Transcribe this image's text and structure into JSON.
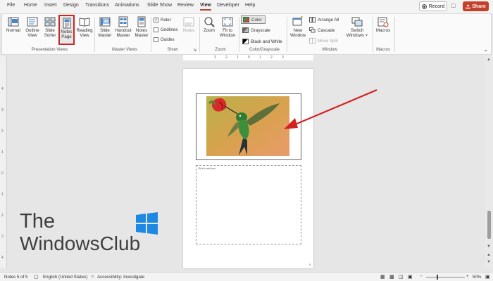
{
  "menu": {
    "tabs": [
      "File",
      "Home",
      "Insert",
      "Design",
      "Transitions",
      "Animations",
      "Slide Show",
      "Review",
      "View",
      "Developer",
      "Help"
    ],
    "active_tab": "View",
    "record_label": "Record",
    "share_label": "Share"
  },
  "ribbon": {
    "presentation_views": {
      "label": "Presentation Views",
      "normal": "Normal",
      "outline_view_1": "Outline",
      "outline_view_2": "View",
      "slide_sorter_1": "Slide",
      "slide_sorter_2": "Sorter",
      "notes_page_1": "Notes",
      "notes_page_2": "Page",
      "reading_view_1": "Reading",
      "reading_view_2": "View"
    },
    "master_views": {
      "label": "Master Views",
      "slide_master_1": "Slide",
      "slide_master_2": "Master",
      "handout_master_1": "Handout",
      "handout_master_2": "Master",
      "notes_master_1": "Notes",
      "notes_master_2": "Master"
    },
    "show": {
      "label": "Show",
      "ruler": "Ruler",
      "gridlines": "Gridlines",
      "guides": "Guides",
      "notes": "Notes"
    },
    "zoom": {
      "label": "Zoom",
      "zoom": "Zoom",
      "fit_1": "Fit to",
      "fit_2": "Window"
    },
    "color_grayscale": {
      "label": "Color/Grayscale",
      "color": "Color",
      "grayscale": "Grayscale",
      "bw": "Black and White"
    },
    "window": {
      "label": "Window",
      "new_window_1": "New",
      "new_window_2": "Window",
      "arrange_all": "Arrange All",
      "cascade": "Cascade",
      "move_split": "Move Split",
      "switch_1": "Switch",
      "switch_2": "Windows ˅"
    },
    "macros": {
      "label": "Macros",
      "macros": "Macros"
    }
  },
  "document": {
    "notes_placeholder": "Click to add text",
    "page_number": "5"
  },
  "rulers": {
    "top": [
      "3",
      "2",
      "1",
      "0",
      "1",
      "2",
      "3"
    ],
    "left": [
      "4",
      "3",
      "2",
      "1",
      "0",
      "1",
      "2",
      "3",
      "4"
    ]
  },
  "status": {
    "slide_info": "Notes 5 of 5",
    "language": "English (United States)",
    "accessibility": "Accessibility: Investigate",
    "zoom_level": "50%"
  },
  "watermark": {
    "line1": "The",
    "line2": "WindowsClub"
  },
  "colors": {
    "accent": "#b7472a",
    "share": "#c4402a",
    "highlight": "#c62828",
    "arrow": "#d32222"
  }
}
